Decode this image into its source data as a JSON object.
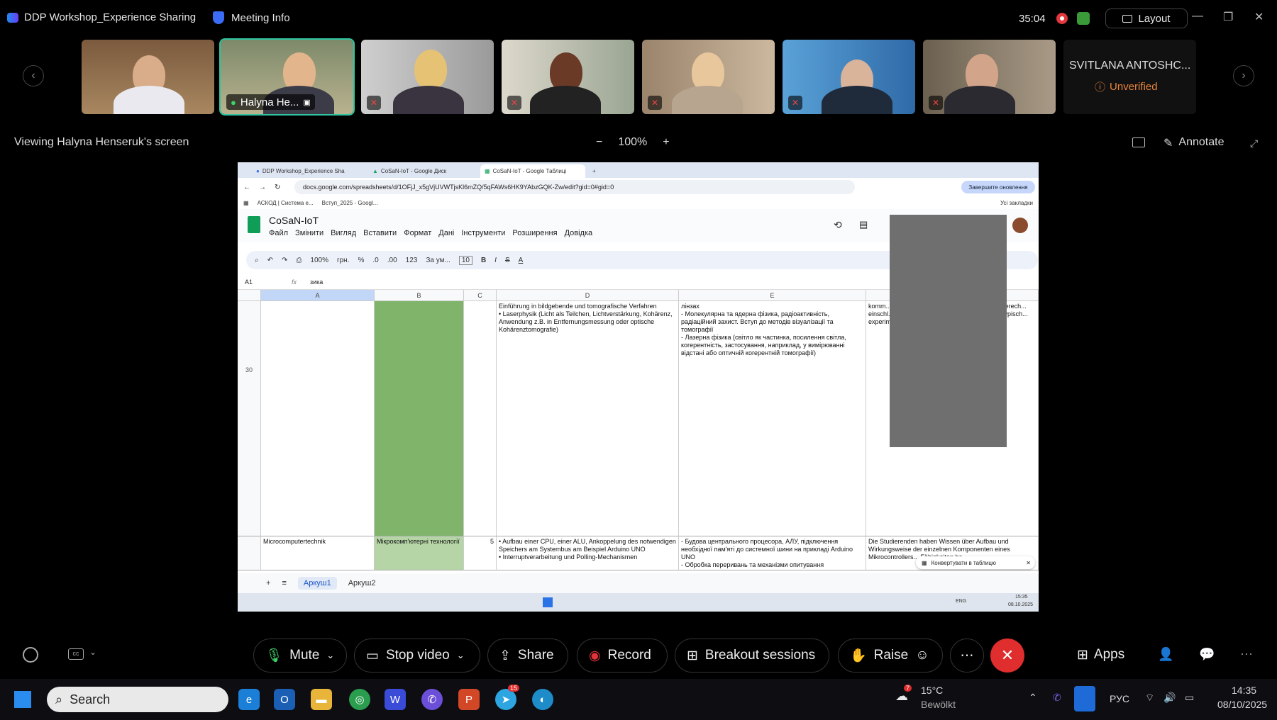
{
  "window": {
    "app_title": "DDP Workshop_Experience Sharing",
    "meeting_info": "Meeting Info",
    "timer": "35:04",
    "layout_label": "Layout"
  },
  "participants": [
    {
      "name": "",
      "muted": false
    },
    {
      "name": "Halyna He...",
      "muted": false
    },
    {
      "name": "",
      "muted": true
    },
    {
      "name": "",
      "muted": true
    },
    {
      "name": "",
      "muted": true
    },
    {
      "name": "",
      "muted": true
    },
    {
      "name": "",
      "muted": true
    }
  ],
  "overflow_participant": {
    "name": "SVITLANA ANTOSHC...",
    "status": "Unverified"
  },
  "viewing": {
    "label": "Viewing Halyna Henseruk's screen",
    "zoom": "100%",
    "minus": "−",
    "plus": "+",
    "annotate": "Annotate"
  },
  "shared": {
    "tabs": [
      "DDP Workshop_Experience Sha",
      "CoSaN-IoT - Google Диск",
      "CoSaN-IoT - Google Таблиці"
    ],
    "url": "docs.google.com/spreadsheets/d/1OFjJ_x5gVjUVWTjsKl6mZQ/5qFAWs6HK9YAbzGQK-Zw/edit?gid=0#gid=0",
    "update_btn": "Завершите оновлення",
    "bookmarks": [
      "АСКОД | Система е...",
      "Вступ_2025 - Googl..."
    ],
    "all_bookmarks": "Усі закладки",
    "doc_title": "CoSaN-IoT",
    "menu": [
      "Файл",
      "Змінити",
      "Вигляд",
      "Вставити",
      "Формат",
      "Дані",
      "Інструменти",
      "Розширення",
      "Довідка"
    ],
    "toolbar": {
      "zoom": "100%",
      "currency": "грн.",
      "percent": "%",
      "dec_minus": ".0",
      "dec_plus": ".00",
      "num": "123",
      "font": "За ум...",
      "size": "10"
    },
    "name_box": "A1",
    "fx": "fx",
    "formula_value": "зика",
    "columns": [
      "A",
      "B",
      "C",
      "D",
      "E"
    ],
    "row_number": "30",
    "row30": {
      "d": "Einführung in bildgebende und tomografische Verfahren\n• Laserphysik (Licht als Teilchen, Lichtverstärkung, Kohärenz, Anwendung z.B. in Entfernungsmessung oder optische Kohärenztomografie)",
      "e": "лінзах\n- Молекулярна та ядерна фізика, радіоактивність, радіаційний захист. Вступ до методів візуалізації та томографії\n- Лазерна фізика (світло як частинка, посилення світла, когерентність, застосування, наприклад, у вимірюванні відстані або оптичній когерентній томографії)",
      "f": "komm... synthet... Result... Studier... Die Stu... Berech... einschl... kritisch... Die Stu... physik... moderr... typisch... experim..."
    },
    "row31": {
      "a": "Microcomputertechnik",
      "b": "Мікрокомп'ютерні технології",
      "c": "5",
      "d": "• Aufbau einer CPU, einer ALU, Ankoppelung des notwendigen Speichers am Systembus am Beispiel Arduino UNO\n• Interruptverarbeitung und Polling-Mechanismen",
      "e": "- Будова центрального процесора, АЛУ, підключення необхідної пам'яті до системної шини на прикладі Arduino UNO\n- Обробка переривань та механізми опитування",
      "f": "Die Studierenden haben Wissen über Aufbau und Wirkungsweise der einzelnen Komponenten eines Mikrocontrollers... Fähigkeiten be..."
    },
    "convert_popup": "Конвертувати в таблицю",
    "sheets": [
      "Аркуш1",
      "Аркуш2"
    ],
    "inner_time": "15:35",
    "inner_date": "08.10.2025",
    "inner_lang": "ENG"
  },
  "controls": {
    "mute": "Mute",
    "stop_video": "Stop video",
    "share": "Share",
    "record": "Record",
    "breakout": "Breakout sessions",
    "raise": "Raise",
    "apps": "Apps"
  },
  "taskbar": {
    "search": "Search",
    "weather_temp": "15°C",
    "weather_desc": "Bewölkt",
    "weather_badge": "7",
    "badge_15": "15",
    "lang": "РУС",
    "time": "14:35",
    "date": "08/10/2025"
  }
}
